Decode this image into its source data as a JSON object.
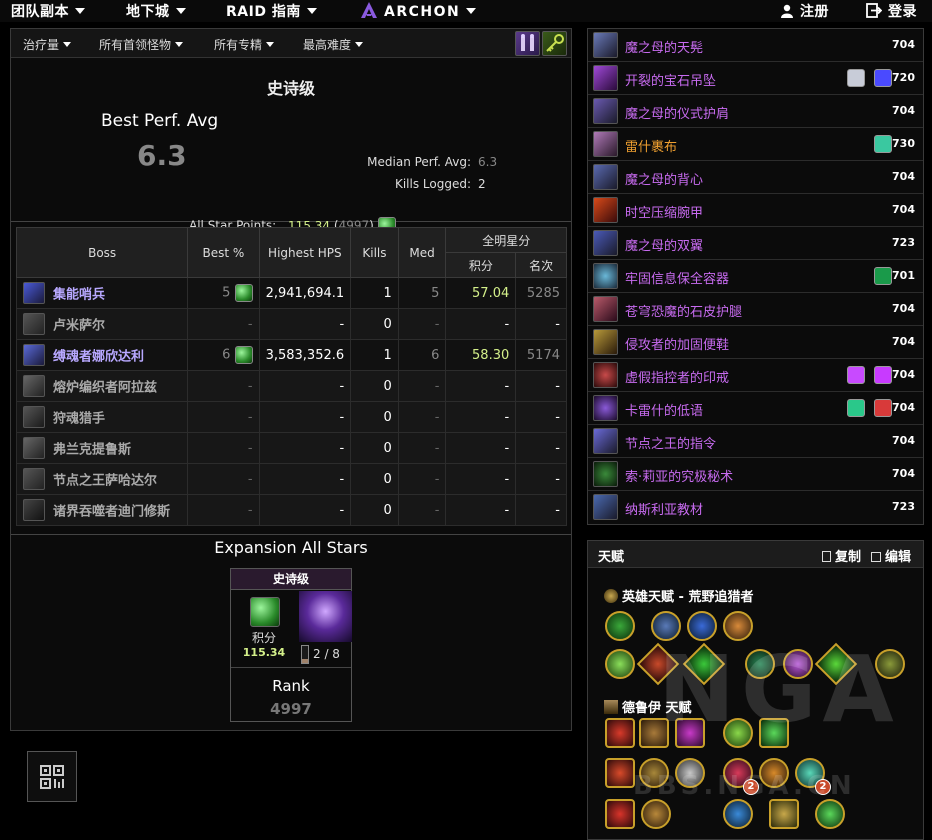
{
  "nav": {
    "raids": "团队副本",
    "dungeons": "地下城",
    "guide": "RAID 指南",
    "archon": "ARCHON",
    "register": "注册",
    "login": "登录"
  },
  "filters": {
    "metric": "治疗量",
    "boss": "所有首领怪物",
    "spec": "所有专精",
    "difficulty": "最高难度"
  },
  "summary": {
    "title": "史诗级",
    "best_label": "Best Perf. Avg",
    "best_value": "6.3",
    "median_label": "Median Perf. Avg:",
    "median_value": "6.3",
    "kills_label": "Kills Logged:",
    "kills_value": "2",
    "star_label": "All Star Points:",
    "star_value": "115.34",
    "star_rank": "4997"
  },
  "table": {
    "headers": {
      "boss": "Boss",
      "best": "Best %",
      "hps": "Highest HPS",
      "kills": "Kills",
      "med": "Med",
      "allstar": "全明星分",
      "points": "积分",
      "rank": "名次"
    },
    "rows": [
      {
        "name": "集能哨兵",
        "best": "5",
        "hps": "2,941,694.1",
        "kills": "1",
        "med": "5",
        "points": "57.04",
        "rank": "5285",
        "killed": true
      },
      {
        "name": "卢米萨尔",
        "best": "-",
        "hps": "-",
        "kills": "0",
        "med": "-",
        "points": "-",
        "rank": "-",
        "killed": false
      },
      {
        "name": "缚魂者娜欣达利",
        "best": "6",
        "hps": "3,583,352.6",
        "kills": "1",
        "med": "6",
        "points": "58.30",
        "rank": "5174",
        "killed": true
      },
      {
        "name": "熔炉编织者阿拉兹",
        "best": "-",
        "hps": "-",
        "kills": "0",
        "med": "-",
        "points": "-",
        "rank": "-",
        "killed": false
      },
      {
        "name": "狩魂猎手",
        "best": "-",
        "hps": "-",
        "kills": "0",
        "med": "-",
        "points": "-",
        "rank": "-",
        "killed": false
      },
      {
        "name": "弗兰克提鲁斯",
        "best": "-",
        "hps": "-",
        "kills": "0",
        "med": "-",
        "points": "-",
        "rank": "-",
        "killed": false
      },
      {
        "name": "节点之王萨哈达尔",
        "best": "-",
        "hps": "-",
        "kills": "0",
        "med": "-",
        "points": "-",
        "rank": "-",
        "killed": false
      },
      {
        "name": "诸界吞噬者迪门修斯",
        "best": "-",
        "hps": "-",
        "kills": "0",
        "med": "-",
        "points": "-",
        "rank": "-",
        "killed": false
      }
    ]
  },
  "expansion": {
    "title": "Expansion All Stars",
    "card_title": "史诗级",
    "points_label": "积分",
    "points_value": "115.34",
    "progress": "2 / 8",
    "rank_label": "Rank",
    "rank_value": "4997"
  },
  "gear": [
    {
      "name": "魔之母的天髡",
      "ilvl": "704",
      "legendary": false,
      "color": "#6a7ab8",
      "sockets": []
    },
    {
      "name": "开裂的宝石吊坠",
      "ilvl": "720",
      "legendary": false,
      "color": "#a04ad8",
      "sockets": [
        "#c8ccd8",
        "#4a4aff"
      ]
    },
    {
      "name": "魔之母的仪式护肩",
      "ilvl": "704",
      "legendary": false,
      "color": "#6a5ab0",
      "sockets": []
    },
    {
      "name": "雷什裹布",
      "ilvl": "730",
      "legendary": true,
      "color": "#b07ab8",
      "sockets": [
        "#3ac8a0"
      ]
    },
    {
      "name": "魔之母的背心",
      "ilvl": "704",
      "legendary": false,
      "color": "#5a6ab0",
      "sockets": []
    },
    {
      "name": "时空压缩腕甲",
      "ilvl": "704",
      "legendary": false,
      "color": "#d84a1a",
      "sockets": []
    },
    {
      "name": "魔之母的双翼",
      "ilvl": "723",
      "legendary": false,
      "color": "#4a5ab8",
      "sockets": []
    },
    {
      "name": "牢固信息保全容器",
      "ilvl": "701",
      "legendary": false,
      "color": "#6ab8d8",
      "sockets": [
        "#1a9a4a"
      ]
    },
    {
      "name": "苍穹恐魔的石皮护腿",
      "ilvl": "704",
      "legendary": false,
      "color": "#b85a6a",
      "sockets": []
    },
    {
      "name": "侵攻者的加固便鞋",
      "ilvl": "704",
      "legendary": false,
      "color": "#b89a3a",
      "sockets": []
    },
    {
      "name": "虚假指控者的印戒",
      "ilvl": "704",
      "legendary": false,
      "color": "#c84a4a",
      "sockets": [
        "#c84aff",
        "#c83aff"
      ]
    },
    {
      "name": "卡雷什的低语",
      "ilvl": "704",
      "legendary": false,
      "color": "#8a5ad8",
      "sockets": [
        "#2ac88a",
        "#d83a3a"
      ]
    },
    {
      "name": "节点之王的指令",
      "ilvl": "704",
      "legendary": false,
      "color": "#6a6ad8",
      "sockets": []
    },
    {
      "name": "索·莉亚的究极秘术",
      "ilvl": "704",
      "legendary": false,
      "color": "#3a8a3a",
      "sockets": []
    },
    {
      "name": "纳斯利亚教材",
      "ilvl": "723",
      "legendary": false,
      "color": "#4a6ab0",
      "sockets": []
    }
  ],
  "talents": {
    "title": "天赋",
    "copy": "复制",
    "edit": "编辑",
    "hero_label": "英雄天赋 - 荒野追猎者",
    "class_label": "德鲁伊 天赋",
    "badge_a": "2",
    "badge_b": "2"
  },
  "watermark": {
    "big": "NGA",
    "small": "BBS.NGA.CN"
  }
}
